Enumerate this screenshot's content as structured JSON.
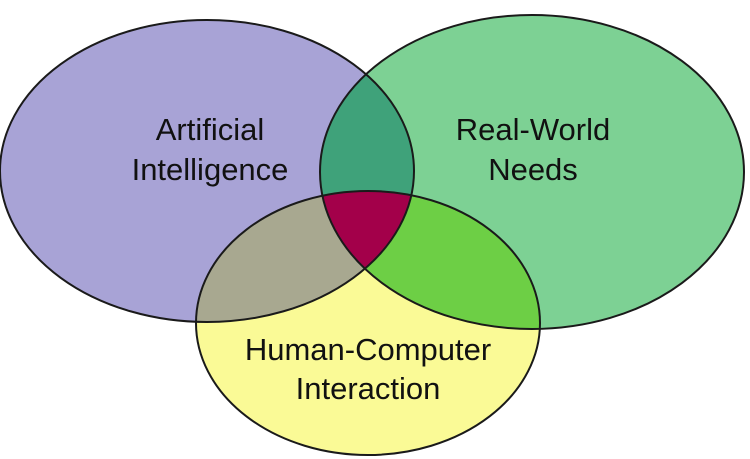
{
  "diagram": {
    "sets": {
      "ai": {
        "label_line1": "Artificial",
        "label_line2": "Intelligence",
        "color": "#A8A3D6"
      },
      "needs": {
        "label_line1": "Real-World",
        "label_line2": "Needs",
        "color": "#7DD194"
      },
      "hci": {
        "label_line1": "Human-Computer",
        "label_line2": "Interaction",
        "color": "#FAFA96"
      }
    },
    "overlaps": {
      "ai_needs": "#3FA27A",
      "ai_hci": "#A8A890",
      "needs_hci": "#6DCF45",
      "center": "#A3004A"
    },
    "stroke": "#1a1a1a"
  }
}
